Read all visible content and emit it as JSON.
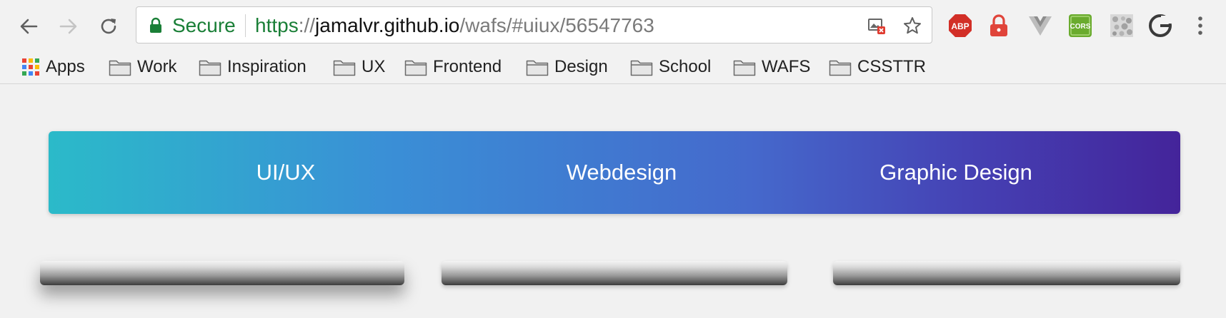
{
  "omnibox": {
    "secure_label": "Secure",
    "url_scheme": "https",
    "url_separator": "://",
    "url_host": "jamalvr.github.io",
    "url_path": "/wafs/#uiux/56547763"
  },
  "extensions": {
    "abp_label": "ABP",
    "cors_label": "CORS"
  },
  "bookmarks": {
    "items": [
      {
        "label": "Apps",
        "icon": "apps-grid-icon"
      },
      {
        "label": "Work",
        "icon": "folder-icon"
      },
      {
        "label": "Inspiration",
        "icon": "folder-icon"
      },
      {
        "label": "UX",
        "icon": "folder-icon"
      },
      {
        "label": "Frontend",
        "icon": "folder-icon"
      },
      {
        "label": "Design",
        "icon": "folder-icon"
      },
      {
        "label": "School",
        "icon": "folder-icon"
      },
      {
        "label": "WAFS",
        "icon": "folder-icon"
      },
      {
        "label": "CSSTTR",
        "icon": "folder-icon"
      }
    ]
  },
  "page": {
    "nav": {
      "items": [
        {
          "label": "UI/UX"
        },
        {
          "label": "Webdesign"
        },
        {
          "label": "Graphic Design"
        }
      ]
    }
  },
  "colors": {
    "secure_green": "#1a7f37",
    "banner_gradient_start": "#2bbac9",
    "banner_gradient_end": "#44249a"
  }
}
